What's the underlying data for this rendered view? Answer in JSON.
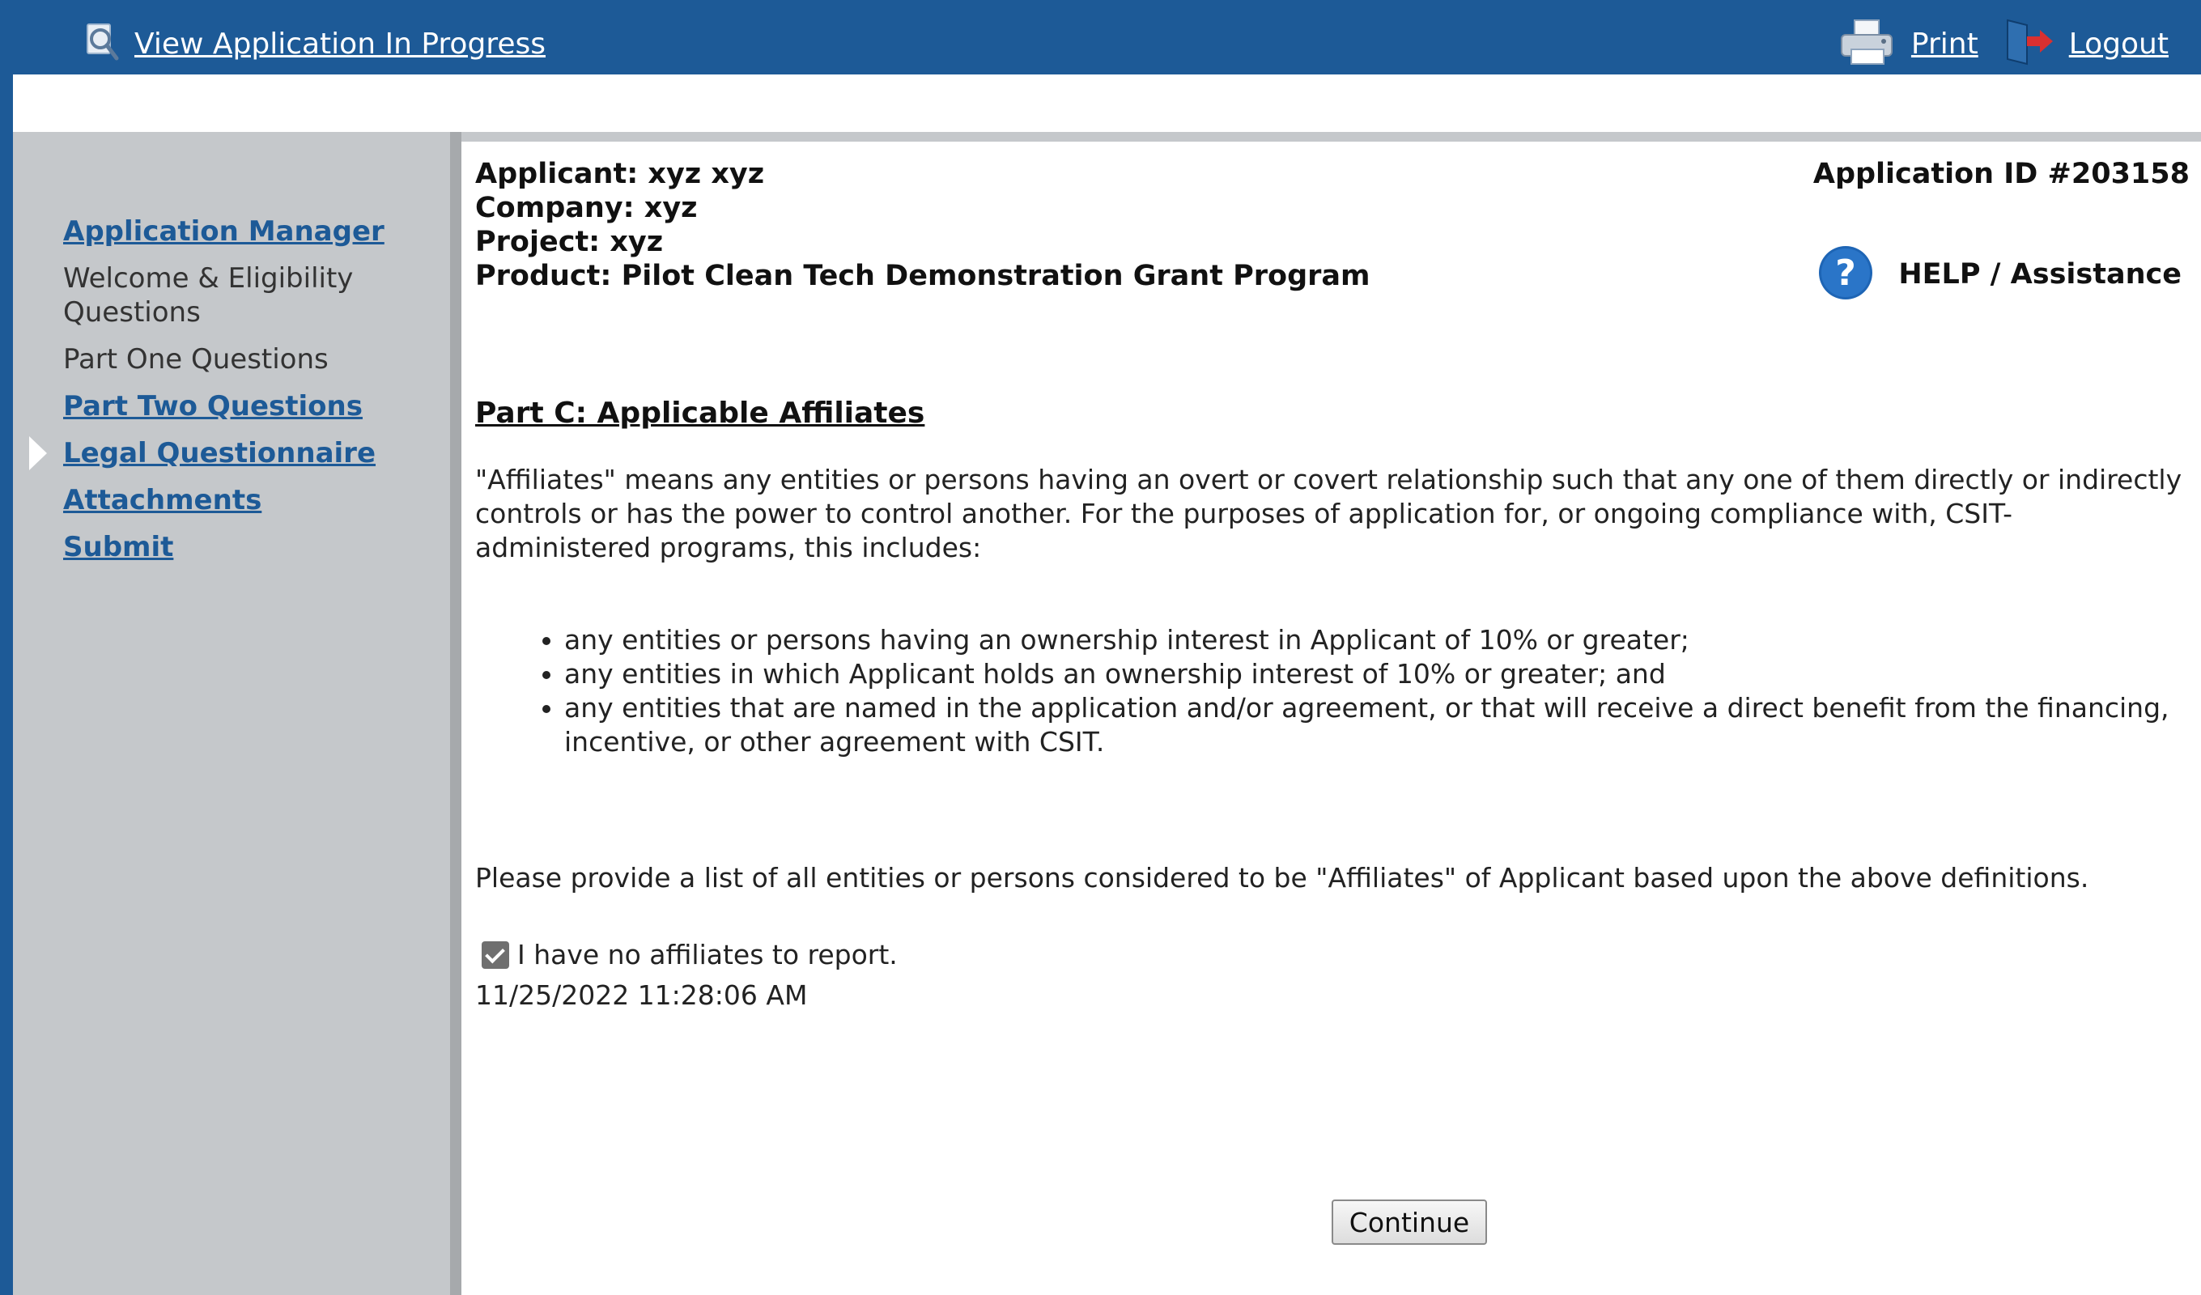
{
  "topbar": {
    "view_label": "View Application In Progress",
    "print_label": "Print",
    "logout_label": "Logout",
    "icons": {
      "view": "magnifier-document-icon",
      "print": "printer-icon",
      "logout": "logout-door-icon"
    }
  },
  "sidebar": {
    "items": [
      {
        "label": "Application Manager",
        "type": "link"
      },
      {
        "label": "Welcome & Eligibility Questions",
        "type": "static"
      },
      {
        "label": "Part One Questions",
        "type": "static"
      },
      {
        "label": "Part Two Questions",
        "type": "link"
      },
      {
        "label": "Legal Questionnaire",
        "type": "link",
        "current": true
      },
      {
        "label": "Attachments",
        "type": "link"
      },
      {
        "label": "Submit",
        "type": "link"
      }
    ]
  },
  "header": {
    "applicant": "Applicant: xyz xyz",
    "company": "Company: xyz",
    "project": "Project: xyz",
    "product": "Product: Pilot Clean Tech Demonstration Grant Program",
    "application_id": "Application ID #203158",
    "help_label": "HELP / Assistance"
  },
  "section": {
    "title": "Part C: Applicable Affiliates",
    "definition": "\"Affiliates\" means any entities or persons having an overt or covert relationship such that any one of them directly or indirectly controls or has the power to control another. For the purposes of application for, or ongoing compliance with, CSIT-administered programs, this includes:",
    "bullets": [
      "any entities or persons having an ownership interest in Applicant of 10% or greater;",
      "any entities in which Applicant holds an ownership interest of 10% or greater; and",
      "any entities that are named in the application and/or agreement, or that will receive a direct benefit from the financing, incentive, or other agreement with CSIT."
    ],
    "request": "Please provide a list of all entities or persons considered to be \"Affiliates\" of Applicant based upon the above definitions.",
    "checkbox_label": "I have no affiliates to report.",
    "checkbox_checked": true,
    "timestamp": "11/25/2022 11:28:06 AM"
  },
  "continue_label": "Continue",
  "colors": {
    "banner": "#1d5a97",
    "sidebar": "#c5c8cb",
    "link": "#1d5a97"
  }
}
